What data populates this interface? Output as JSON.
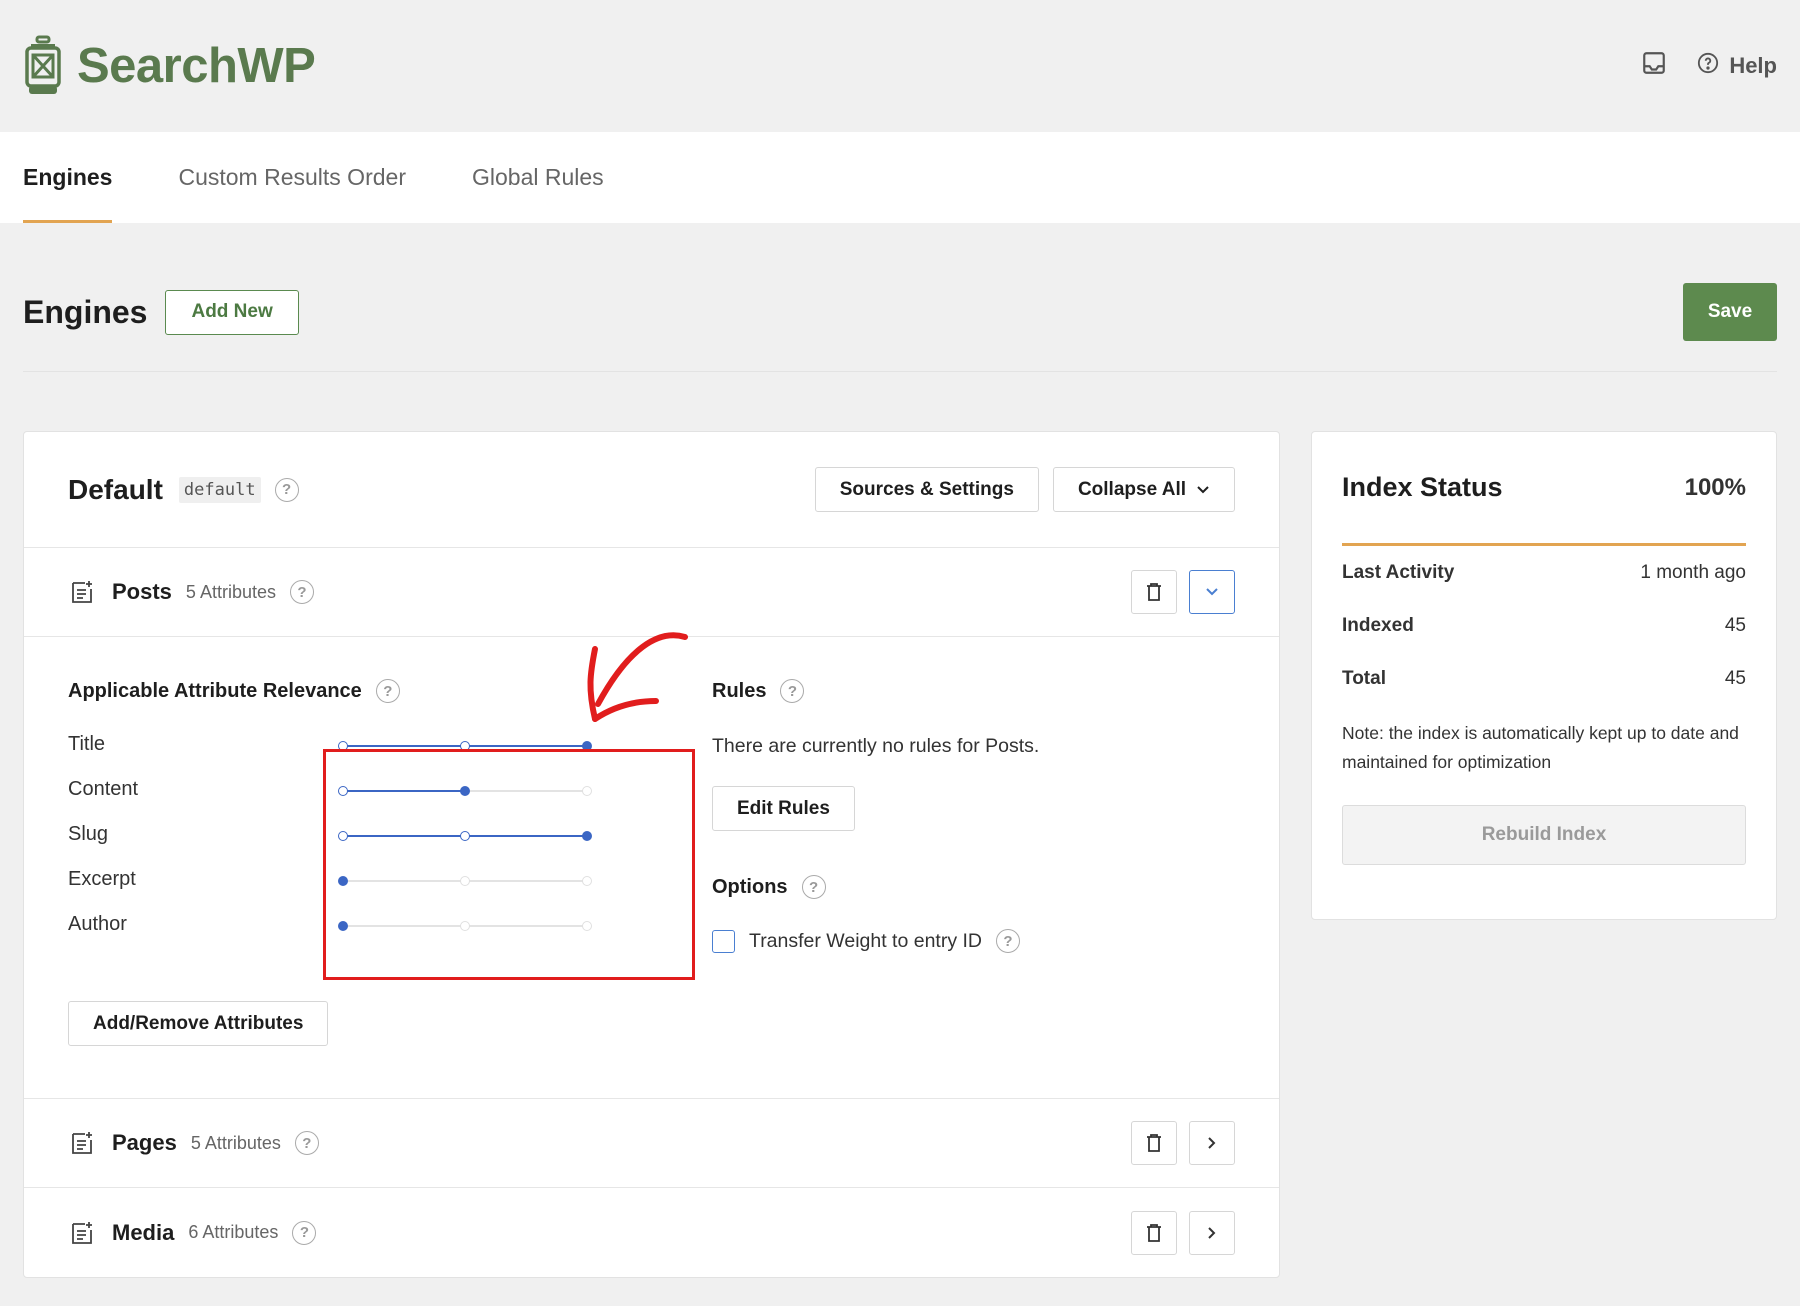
{
  "app": {
    "name": "SearchWP",
    "help_label": "Help"
  },
  "tabs": [
    {
      "label": "Engines",
      "active": true
    },
    {
      "label": "Custom Results Order",
      "active": false
    },
    {
      "label": "Global Rules",
      "active": false
    }
  ],
  "page": {
    "title": "Engines",
    "add_new_label": "Add New",
    "save_label": "Save"
  },
  "engine": {
    "name": "Default",
    "slug": "default",
    "sources_settings_label": "Sources & Settings",
    "collapse_all_label": "Collapse All",
    "sources": [
      {
        "name": "Posts",
        "attributes": "5 Attributes",
        "expanded": true
      },
      {
        "name": "Pages",
        "attributes": "5 Attributes",
        "expanded": false
      },
      {
        "name": "Media",
        "attributes": "6 Attributes",
        "expanded": false
      }
    ],
    "relevance": {
      "title": "Applicable Attribute Relevance",
      "attributes": [
        {
          "label": "Title",
          "level": 2
        },
        {
          "label": "Content",
          "level": 1
        },
        {
          "label": "Slug",
          "level": 2
        },
        {
          "label": "Excerpt",
          "level": 0
        },
        {
          "label": "Author",
          "level": 0
        }
      ],
      "add_remove_label": "Add/Remove Attributes"
    },
    "rules": {
      "title": "Rules",
      "empty_text": "There are currently no rules for Posts.",
      "edit_label": "Edit Rules"
    },
    "options": {
      "title": "Options",
      "transfer_weight_label": "Transfer Weight to entry ID",
      "transfer_weight_checked": false
    }
  },
  "index_status": {
    "title": "Index Status",
    "percent": "100%",
    "stats": [
      {
        "label": "Last Activity",
        "value": "1 month ago"
      },
      {
        "label": "Indexed",
        "value": "45"
      },
      {
        "label": "Total",
        "value": "45"
      }
    ],
    "note": "Note: the index is automatically kept up to date and maintained for optimization",
    "rebuild_label": "Rebuild Index"
  },
  "colors": {
    "brand_green": "#5a7a4e",
    "accent_orange": "#e2a451",
    "slider_blue": "#3b66c4",
    "highlight_red": "#e11d1d"
  },
  "icons": {
    "logo": "lantern-icon",
    "inbox": "inbox-icon",
    "help": "question-circle-icon",
    "source": "document-plus-icon",
    "delete": "trash-icon",
    "expand": "chevron-down-icon",
    "collapse": "chevron-right-icon"
  }
}
